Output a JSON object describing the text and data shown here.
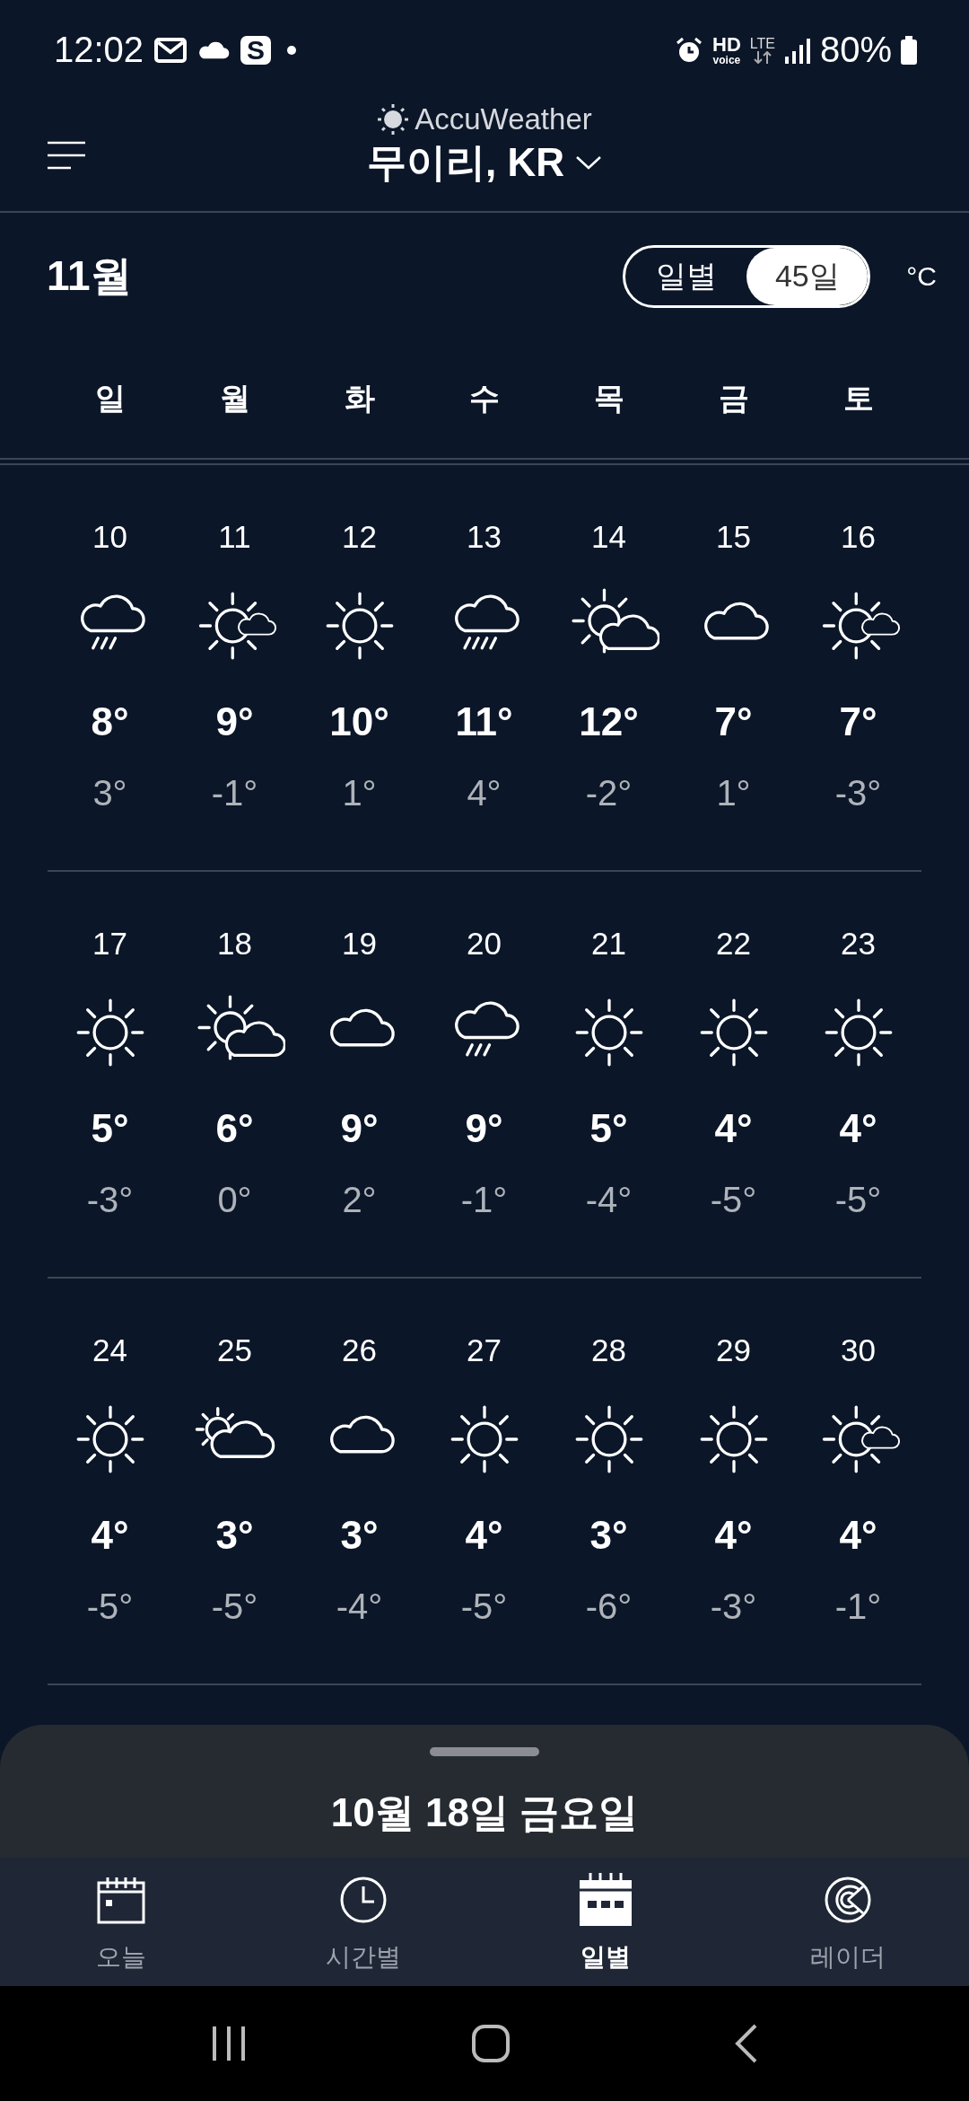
{
  "status_bar": {
    "time": "12:02",
    "app_badge": "S",
    "hd": "HD",
    "voice": "voice",
    "network": "LTE",
    "battery": "80%"
  },
  "header": {
    "brand": "AccuWeather",
    "location": "무이리, KR"
  },
  "month_bar": {
    "month": "11월",
    "toggle": [
      {
        "label": "일별",
        "selected": false
      },
      {
        "label": "45일",
        "selected": true
      }
    ],
    "unit": "°C"
  },
  "weekdays": [
    "일",
    "월",
    "화",
    "수",
    "목",
    "금",
    "토"
  ],
  "weeks": [
    [
      {
        "date": "10",
        "kind": "rain",
        "high": "8°",
        "low": "3°"
      },
      {
        "date": "11",
        "kind": "sun-small-cloud",
        "high": "9°",
        "low": "-1°"
      },
      {
        "date": "12",
        "kind": "sun",
        "high": "10°",
        "low": "1°"
      },
      {
        "date": "13",
        "kind": "showers",
        "high": "11°",
        "low": "4°"
      },
      {
        "date": "14",
        "kind": "sun-cloud",
        "high": "12°",
        "low": "-2°"
      },
      {
        "date": "15",
        "kind": "cloud",
        "high": "7°",
        "low": "1°"
      },
      {
        "date": "16",
        "kind": "sun-small-cloud",
        "high": "7°",
        "low": "-3°"
      }
    ],
    [
      {
        "date": "17",
        "kind": "sun",
        "high": "5°",
        "low": "-3°"
      },
      {
        "date": "18",
        "kind": "sun-cloud",
        "high": "6°",
        "low": "0°"
      },
      {
        "date": "19",
        "kind": "cloud",
        "high": "9°",
        "low": "2°"
      },
      {
        "date": "20",
        "kind": "rain",
        "high": "9°",
        "low": "-1°"
      },
      {
        "date": "21",
        "kind": "sun",
        "high": "5°",
        "low": "-4°"
      },
      {
        "date": "22",
        "kind": "sun",
        "high": "4°",
        "low": "-5°"
      },
      {
        "date": "23",
        "kind": "sun",
        "high": "4°",
        "low": "-5°"
      }
    ],
    [
      {
        "date": "24",
        "kind": "sun",
        "high": "4°",
        "low": "-5°"
      },
      {
        "date": "25",
        "kind": "cloud-sun",
        "high": "3°",
        "low": "-5°"
      },
      {
        "date": "26",
        "kind": "cloud",
        "high": "3°",
        "low": "-4°"
      },
      {
        "date": "27",
        "kind": "sun",
        "high": "4°",
        "low": "-5°"
      },
      {
        "date": "28",
        "kind": "sun",
        "high": "3°",
        "low": "-6°"
      },
      {
        "date": "29",
        "kind": "sun",
        "high": "4°",
        "low": "-3°"
      },
      {
        "date": "30",
        "kind": "sun-small-cloud",
        "high": "4°",
        "low": "-1°"
      }
    ]
  ],
  "sheet": {
    "title": "10월 18일 금요일"
  },
  "nav": [
    {
      "kind": "today",
      "label": "오늘",
      "selected": false
    },
    {
      "kind": "hourly",
      "label": "시간별",
      "selected": false
    },
    {
      "kind": "daily",
      "label": "일별",
      "selected": true
    },
    {
      "kind": "radar",
      "label": "레이더",
      "selected": false
    }
  ]
}
